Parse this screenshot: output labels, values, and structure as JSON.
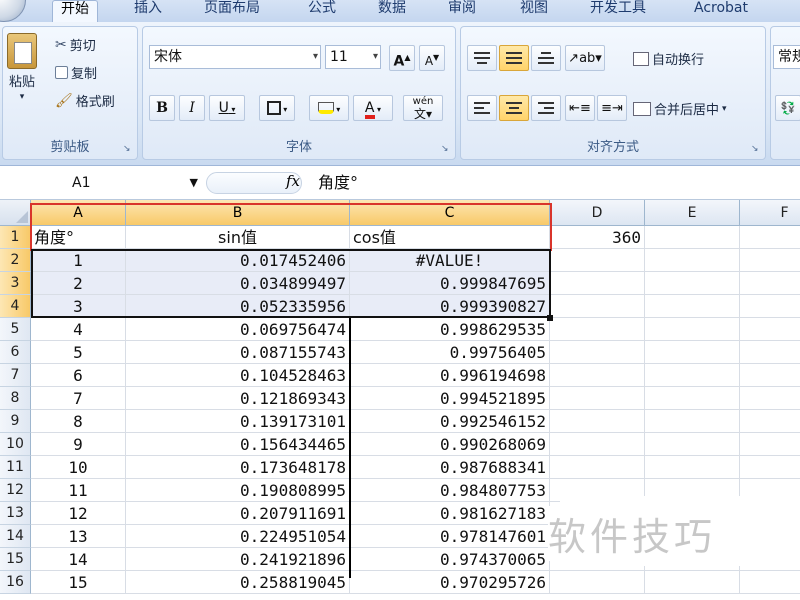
{
  "ribbon": {
    "tabs": [
      "开始",
      "插入",
      "页面布局",
      "公式",
      "数据",
      "审阅",
      "视图",
      "开发工具",
      "Acrobat"
    ],
    "clipboard": {
      "paste": "粘贴",
      "cut": "剪切",
      "copy": "复制",
      "format_painter": "格式刷",
      "label": "剪贴板"
    },
    "font": {
      "name": "宋体",
      "size": "11",
      "grow": "A",
      "shrink": "A",
      "bold": "B",
      "italic": "I",
      "underline": "U",
      "font_color_glyph": "A",
      "phonetic": "wén",
      "label": "字体"
    },
    "alignment": {
      "wrap_text": "自动换行",
      "merge_center": "合并后居中",
      "label": "对齐方式"
    },
    "number": {
      "format": "常规"
    }
  },
  "formula_bar": {
    "name_box": "A1",
    "fx": "fx",
    "content": "角度°"
  },
  "grid": {
    "columns": [
      "A",
      "B",
      "C",
      "D",
      "E",
      "F"
    ],
    "rows": [
      "1",
      "2",
      "3",
      "4",
      "5",
      "6",
      "7",
      "8",
      "9",
      "10",
      "11",
      "12",
      "13",
      "14",
      "15",
      "16"
    ],
    "header_row": {
      "a": "角度°",
      "b": "sin值",
      "c": "cos值",
      "d": "360"
    },
    "data": [
      {
        "a": "1",
        "b": "0.017452406",
        "c": "#VALUE!"
      },
      {
        "a": "2",
        "b": "0.034899497",
        "c": "0.999847695"
      },
      {
        "a": "3",
        "b": "0.052335956",
        "c": "0.999390827"
      },
      {
        "a": "4",
        "b": "0.069756474",
        "c": "0.998629535"
      },
      {
        "a": "5",
        "b": "0.087155743",
        "c": "0.99756405"
      },
      {
        "a": "6",
        "b": "0.104528463",
        "c": "0.996194698"
      },
      {
        "a": "7",
        "b": "0.121869343",
        "c": "0.994521895"
      },
      {
        "a": "8",
        "b": "0.139173101",
        "c": "0.992546152"
      },
      {
        "a": "9",
        "b": "0.156434465",
        "c": "0.990268069"
      },
      {
        "a": "10",
        "b": "0.173648178",
        "c": "0.987688341"
      },
      {
        "a": "11",
        "b": "0.190808995",
        "c": "0.984807753"
      },
      {
        "a": "12",
        "b": "0.207911691",
        "c": "0.981627183"
      },
      {
        "a": "13",
        "b": "0.224951054",
        "c": "0.978147601"
      },
      {
        "a": "14",
        "b": "0.241921896",
        "c": "0.974370065"
      },
      {
        "a": "15",
        "b": "0.258819045",
        "c": "0.970295726"
      }
    ]
  },
  "watermark": "软件技巧",
  "colors": {
    "highlight_border": "#d9342b",
    "selected_header": "#f8c968"
  }
}
